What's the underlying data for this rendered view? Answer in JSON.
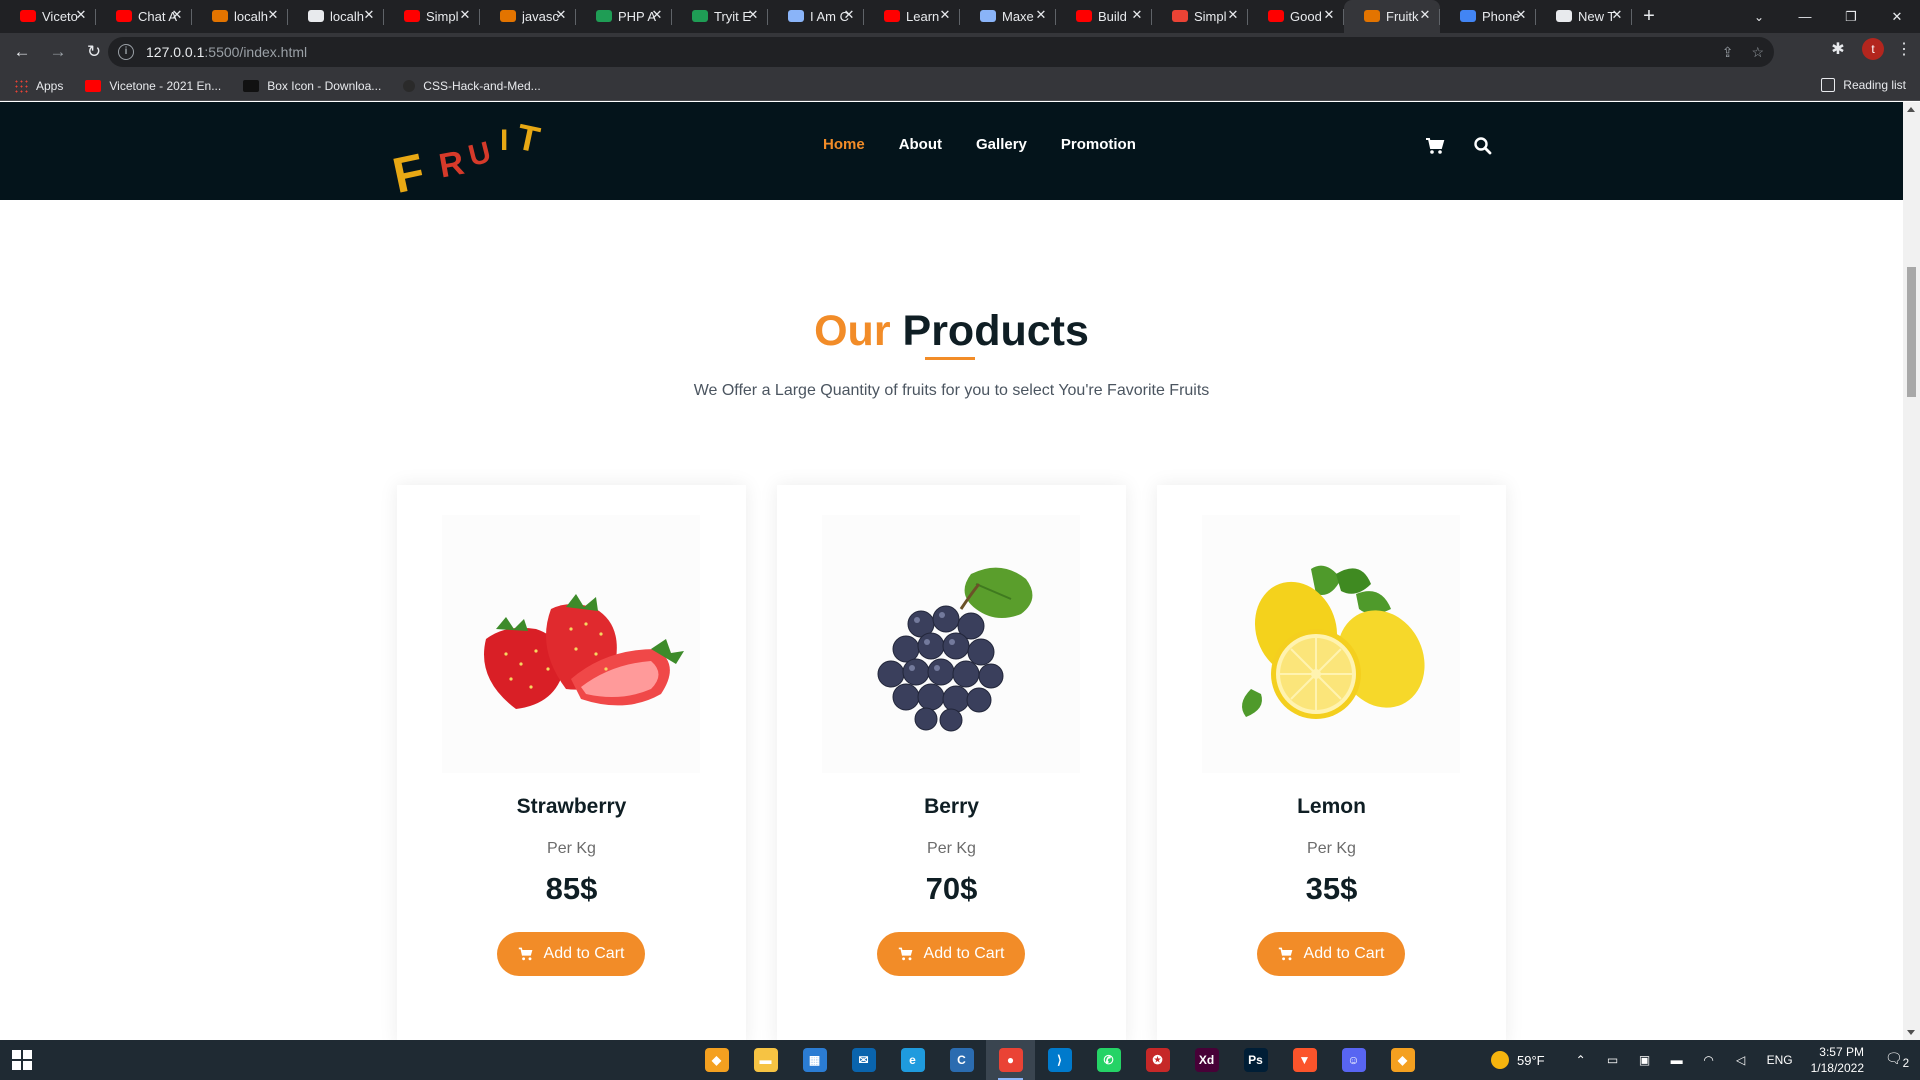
{
  "browser": {
    "tabs": [
      {
        "label": "Viceto",
        "color": "#ff0000"
      },
      {
        "label": "Chat A",
        "color": "#ff0000"
      },
      {
        "label": "localh",
        "color": "#e37400"
      },
      {
        "label": "localh",
        "color": "#e8eaed"
      },
      {
        "label": "Simpl",
        "color": "#ff0000"
      },
      {
        "label": "javasc",
        "color": "#e37400"
      },
      {
        "label": "PHP A",
        "color": "#1f9d55"
      },
      {
        "label": "Tryit E",
        "color": "#1f9d55"
      },
      {
        "label": "I Am C",
        "color": "#8ab4f8"
      },
      {
        "label": "Learn",
        "color": "#ff0000"
      },
      {
        "label": "Maxe",
        "color": "#8ab4f8"
      },
      {
        "label": "Build",
        "color": "#ff0000"
      },
      {
        "label": "Simpl",
        "color": "#ea4335"
      },
      {
        "label": "Good",
        "color": "#ff0000"
      },
      {
        "label": "Fruitk",
        "color": "#e37400"
      },
      {
        "label": "Phone",
        "color": "#4285f4"
      },
      {
        "label": "New T",
        "color": "#e8eaed"
      }
    ],
    "active_tab_index": 14,
    "url_host": "127.0.0.1",
    "url_path": ":5500/index.html",
    "profile_initial": "t",
    "bookmarks": [
      {
        "label": "Apps"
      },
      {
        "label": "Vicetone - 2021 En..."
      },
      {
        "label": "Box Icon - Downloa..."
      },
      {
        "label": "CSS-Hack-and-Med..."
      }
    ],
    "reading_list": "Reading list"
  },
  "site": {
    "logo_text": "FRUIT",
    "nav": [
      {
        "label": "Home",
        "active": true
      },
      {
        "label": "About",
        "active": false
      },
      {
        "label": "Gallery",
        "active": false
      },
      {
        "label": "Promotion",
        "active": false
      }
    ],
    "icons": [
      "cart-icon",
      "search-icon"
    ]
  },
  "products_section": {
    "title_accent": "Our",
    "title_main": "Products",
    "subtitle": "We Offer a Large Quantity of fruits for you to select You're Favorite Fruits",
    "accent_color": "#f28c28",
    "products": [
      {
        "name": "Strawberry",
        "unit": "Per Kg",
        "price": "85$",
        "button": "Add to Cart",
        "image": "strawberry"
      },
      {
        "name": "Berry",
        "unit": "Per Kg",
        "price": "70$",
        "button": "Add to Cart",
        "image": "grapes"
      },
      {
        "name": "Lemon",
        "unit": "Per Kg",
        "price": "35$",
        "button": "Add to Cart",
        "image": "lemon"
      }
    ]
  },
  "taskbar": {
    "apps": [
      {
        "name": "git-icon",
        "color": "#f4a020",
        "glyph": "◆"
      },
      {
        "name": "file-explorer-icon",
        "color": "#f6c343",
        "glyph": "▬"
      },
      {
        "name": "store-icon",
        "color": "#2b7cd3",
        "glyph": "▦"
      },
      {
        "name": "mail-icon",
        "color": "#0a64ad",
        "glyph": "✉"
      },
      {
        "name": "edge-icon",
        "color": "#1f9bde",
        "glyph": "e"
      },
      {
        "name": "ccleaner-icon",
        "color": "#2b6cb0",
        "glyph": "C"
      },
      {
        "name": "chrome-icon",
        "color": "#ea4335",
        "glyph": "●"
      },
      {
        "name": "vscode-icon",
        "color": "#007acc",
        "glyph": "⟩"
      },
      {
        "name": "whatsapp-icon",
        "color": "#25d366",
        "glyph": "✆"
      },
      {
        "name": "game-icon",
        "color": "#c62828",
        "glyph": "✪"
      },
      {
        "name": "adobe-xd-icon",
        "color": "#470137",
        "glyph": "Xd"
      },
      {
        "name": "photoshop-icon",
        "color": "#001e36",
        "glyph": "Ps"
      },
      {
        "name": "brave-icon",
        "color": "#fb542b",
        "glyph": "▼"
      },
      {
        "name": "discord-icon",
        "color": "#5865f2",
        "glyph": "☺"
      },
      {
        "name": "gitkraken-icon",
        "color": "#f4a020",
        "glyph": "◆"
      }
    ],
    "active_app_index": 6,
    "weather": "59°F",
    "language": "ENG",
    "time": "3:57 PM",
    "date": "1/18/2022",
    "notifications": "2"
  }
}
